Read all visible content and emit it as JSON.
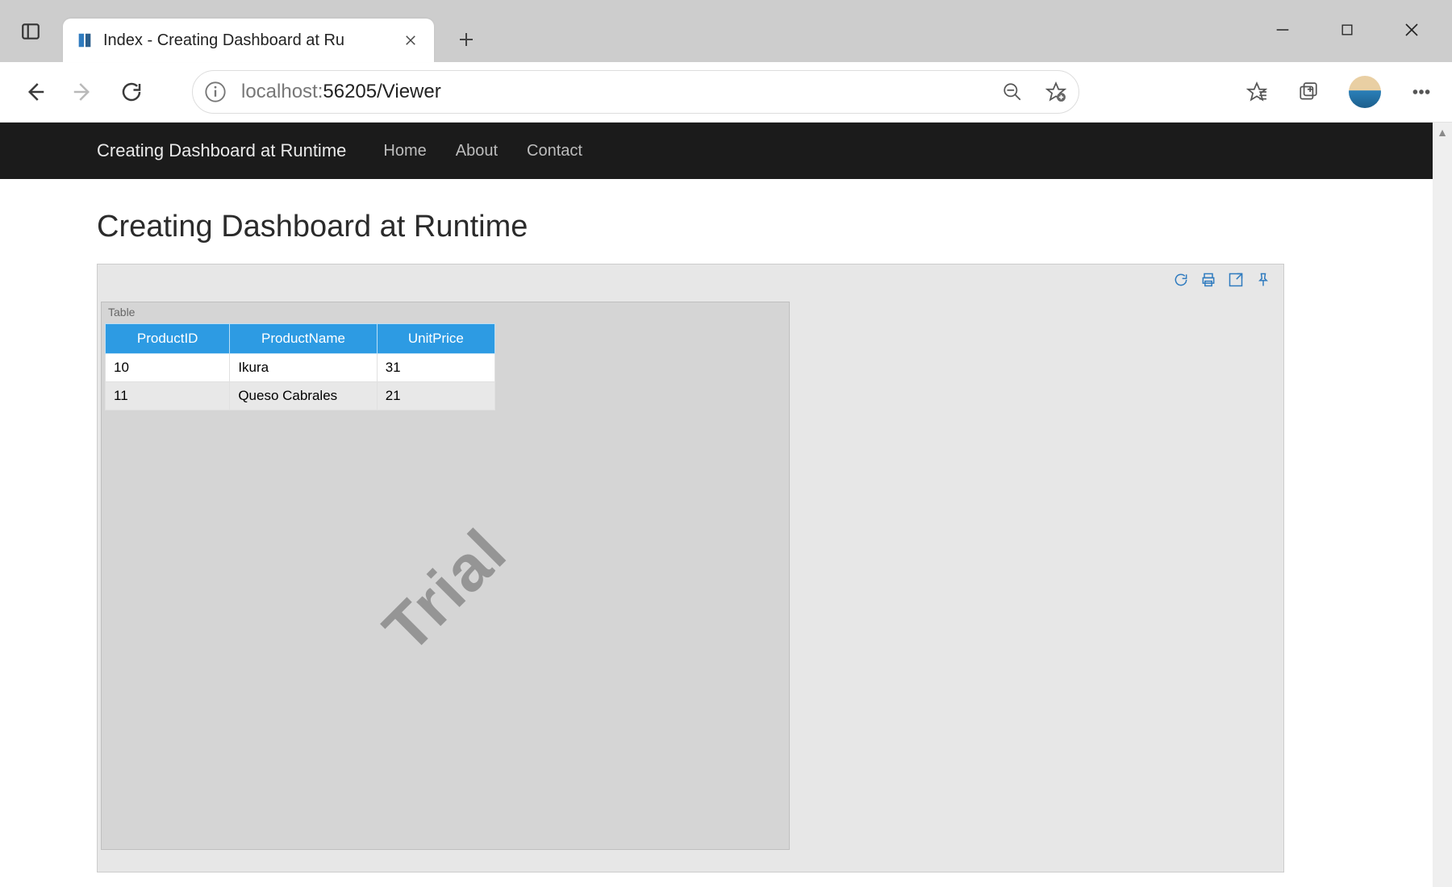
{
  "browser": {
    "tab_title": "Index - Creating Dashboard at Ru",
    "url_host": "localhost:",
    "url_port_path": "56205/Viewer"
  },
  "site": {
    "brand": "Creating Dashboard at Runtime",
    "nav": {
      "home": "Home",
      "about": "About",
      "contact": "Contact"
    },
    "heading": "Creating Dashboard at Runtime"
  },
  "dashboard": {
    "widget_title": "Table",
    "watermark": "Trial",
    "table": {
      "columns": [
        "ProductID",
        "ProductName",
        "UnitPrice"
      ],
      "rows": [
        {
          "ProductID": "10",
          "ProductName": "Ikura",
          "UnitPrice": "31"
        },
        {
          "ProductID": "11",
          "ProductName": "Queso Cabrales",
          "UnitPrice": "21"
        }
      ]
    }
  }
}
